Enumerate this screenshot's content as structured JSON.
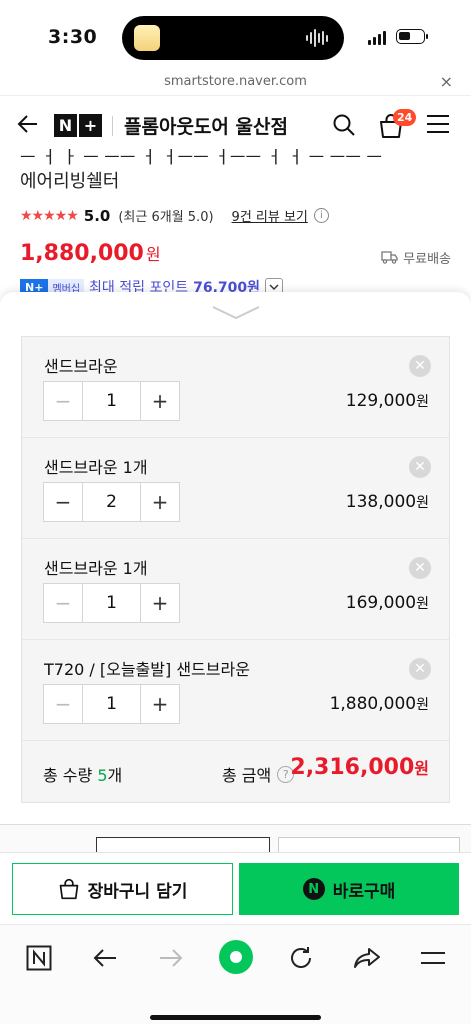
{
  "status": {
    "time": "3:30"
  },
  "browser": {
    "url": "smartstore.naver.com",
    "close": "×"
  },
  "header": {
    "logo_n": "N",
    "logo_plus": "+",
    "store_name": "플롬아웃도어 울산점",
    "cart_count": "24",
    "icons": [
      "back-arrow-icon",
      "search-icon",
      "shopping-bag-icon",
      "menu-icon"
    ]
  },
  "product": {
    "title_cut": "ㅡ ㅓ ㅏ ㅡ ㅡㅡ ㅓ ㅓㅡㅡ ㅓㅡㅡ ㅓ ㅓ ㅡ ㅡㅡ ㅡ",
    "title": "에어리빙쉘터",
    "stars": "★★★★★",
    "rating": "5.0",
    "rating_sub": "(최근 6개월 5.0)",
    "review_link": "9건 리뷰 보기",
    "info": "i",
    "price": "1,880,000",
    "price_unit": "원",
    "free_shipping": "무료배송",
    "member_n": "N+",
    "member_badge": "멤버십",
    "member_text": "최대 적립 포인트",
    "member_points": "76,700원"
  },
  "options": [
    {
      "name": "샌드브라운",
      "qty": "1",
      "price": "129,000",
      "unit": "원",
      "minus_disabled": true
    },
    {
      "name": "샌드브라운 1개",
      "qty": "2",
      "price": "138,000",
      "unit": "원",
      "minus_disabled": false
    },
    {
      "name": "샌드브라운 1개",
      "qty": "1",
      "price": "169,000",
      "unit": "원",
      "minus_disabled": true
    },
    {
      "name": "T720 / [오늘출발] 샌드브라운",
      "qty": "1",
      "price": "1,880,000",
      "unit": "원",
      "minus_disabled": true
    }
  ],
  "stepper": {
    "minus": "−",
    "plus": "+"
  },
  "total": {
    "qty_label": "총 수량",
    "qty_value": "5",
    "qty_unit": "개",
    "amount_label": "총 금액",
    "help": "?",
    "amount": "2,316,000",
    "amount_unit": "원"
  },
  "actions": {
    "cart": "장바구니 담기",
    "buy": "바로구매",
    "buy_icon_letter": "N"
  },
  "colors": {
    "price_red": "#e81b2a",
    "naver_green": "#03c75a",
    "member_blue": "#4a4fd6"
  }
}
